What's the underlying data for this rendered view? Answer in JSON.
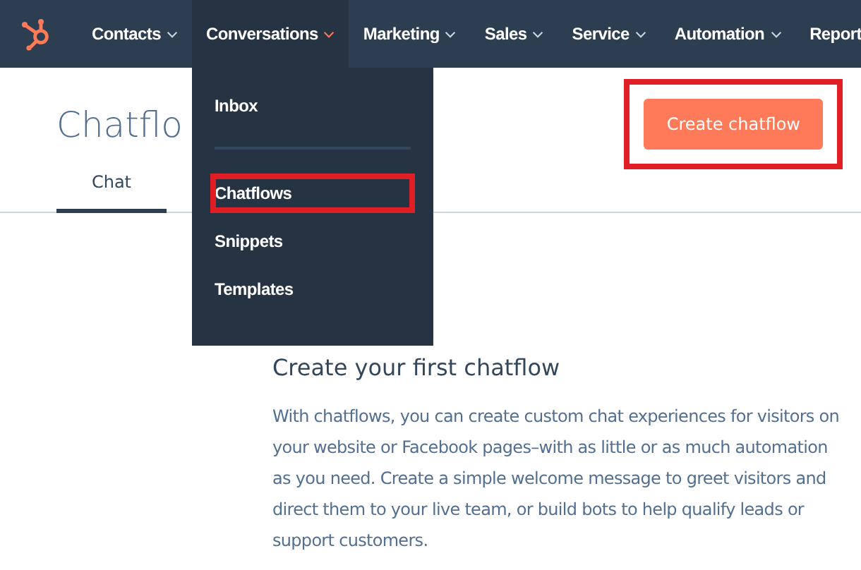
{
  "nav": {
    "items": [
      {
        "label": "Contacts",
        "selected": false,
        "caret": true
      },
      {
        "label": "Conversations",
        "selected": true,
        "caret": true
      },
      {
        "label": "Marketing",
        "selected": false,
        "caret": true
      },
      {
        "label": "Sales",
        "selected": false,
        "caret": true
      },
      {
        "label": "Service",
        "selected": false,
        "caret": true
      },
      {
        "label": "Automation",
        "selected": false,
        "caret": true
      },
      {
        "label": "Report",
        "selected": false,
        "caret": false
      }
    ]
  },
  "dropdown": {
    "items": [
      {
        "label": "Inbox",
        "highlighted": false,
        "divider_after": true
      },
      {
        "label": "Chatflows",
        "highlighted": true,
        "divider_after": false
      },
      {
        "label": "Snippets",
        "highlighted": false,
        "divider_after": false
      },
      {
        "label": "Templates",
        "highlighted": false,
        "divider_after": false
      }
    ]
  },
  "page": {
    "title": "Chatflo",
    "create_button": {
      "label": "Create chatflow",
      "highlighted": true
    },
    "tabs": [
      {
        "label": "Chat",
        "selected": true
      }
    ]
  },
  "empty_state": {
    "heading": "Create your first chatflow",
    "body": "With chatflows, you can create custom chat experiences for visitors on your website or Facebook pages–with as little or as much automation as you need. Create a simple welcome message to greet visitors and direct them to your live team, or build bots to help qualify leads or support customers."
  }
}
